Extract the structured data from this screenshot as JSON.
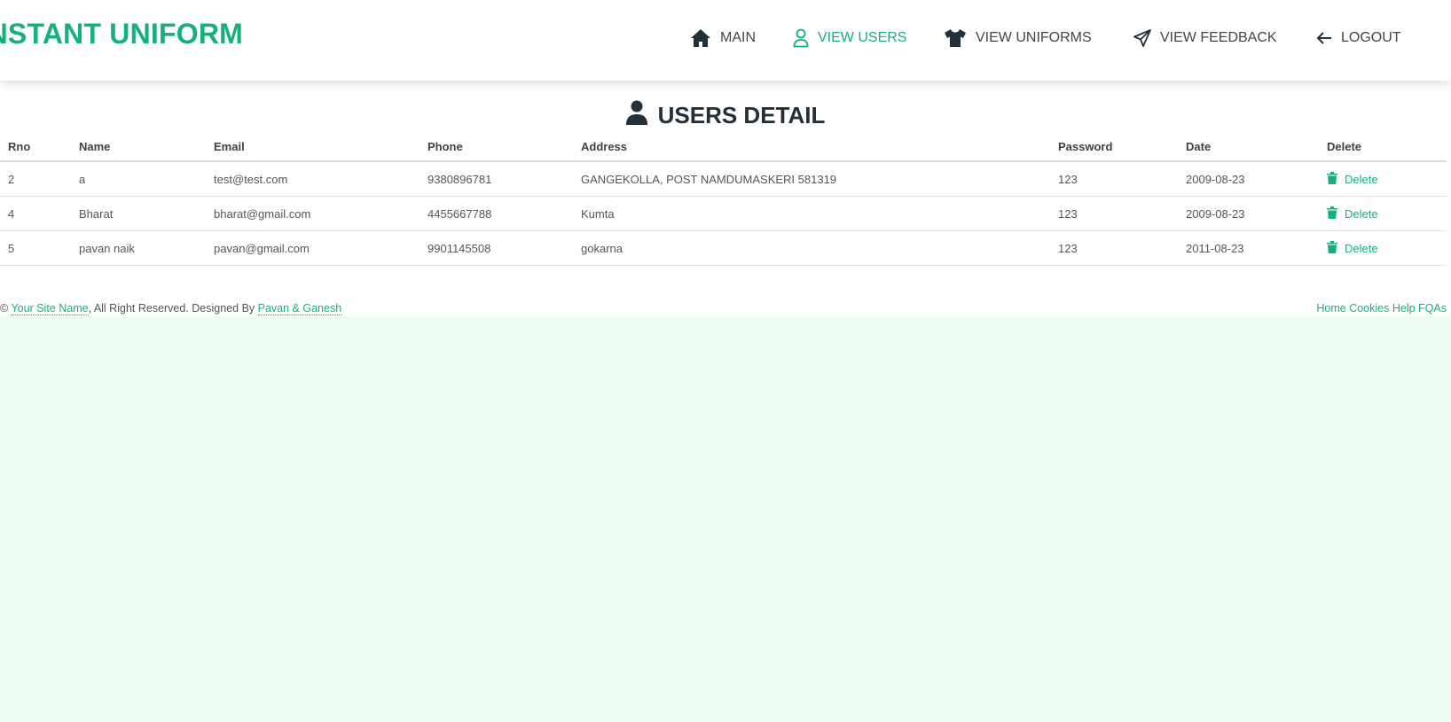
{
  "brand": {
    "logo_text": "INSTANT UNIFORM",
    "color": "#16b07a"
  },
  "nav": {
    "main": "MAIN",
    "view_users": "VIEW USERS",
    "view_uniforms": "VIEW UNIFORMS",
    "view_feedback": "VIEW FEEDBACK",
    "logout": "LOGOUT",
    "active": "view_users"
  },
  "page": {
    "title": "USERS DETAIL",
    "title_icon": "user-icon"
  },
  "table": {
    "headers": [
      "Rno",
      "Name",
      "Email",
      "Phone",
      "Address",
      "Password",
      "Date",
      "Delete"
    ],
    "rows": [
      {
        "rno": "2",
        "name": "a",
        "email": "test@test.com",
        "phone": "9380896781",
        "address": "GANGEKOLLA, POST NAMDUMASKERI 581319",
        "password": "123",
        "date": "2009-08-23",
        "action": "Delete"
      },
      {
        "rno": "4",
        "name": "Bharat",
        "email": "bharat@gmail.com",
        "phone": "4455667788",
        "address": "Kumta",
        "password": "123",
        "date": "2009-08-23",
        "action": "Delete"
      },
      {
        "rno": "5",
        "name": "pavan naik",
        "email": "pavan@gmail.com",
        "phone": "9901145508",
        "address": "gokarna",
        "password": "123",
        "date": "2011-08-23",
        "action": "Delete"
      }
    ]
  },
  "footer": {
    "copyright": "©",
    "site_name": "Your Site Name",
    "reserved": ", All Right Reserved. Designed By",
    "designer": "Pavan & Ganesh",
    "links": [
      "Home",
      "Cookies",
      "Help",
      "FQAs"
    ]
  }
}
